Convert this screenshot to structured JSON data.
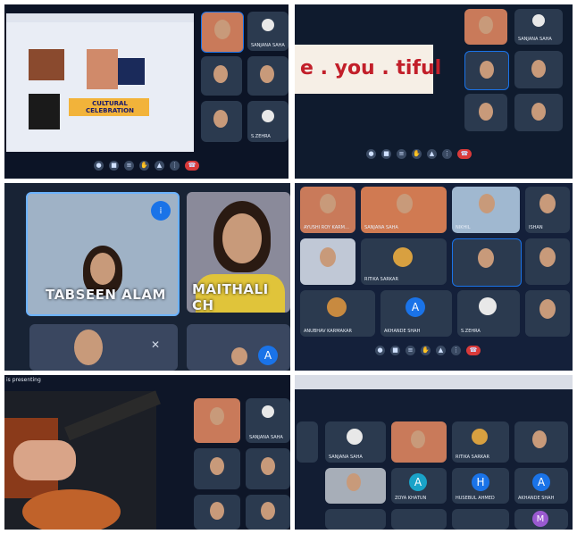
{
  "collage": {
    "p1": {
      "presentation_title": "CULTURAL CELEBRATION",
      "tiles": [
        "",
        "SANJANA SAHA",
        "",
        "",
        "",
        "S.ZEHRA"
      ]
    },
    "p2": {
      "banner_text": "e . you . tiful",
      "tiles": [
        "",
        "SANJANA SAHA",
        "",
        "",
        "",
        ""
      ]
    },
    "p3": {
      "tile_left_name": "TABSEEN ALAM",
      "tile_right_name": "MAITHALI CH",
      "avatar_letter": "A"
    },
    "p4": {
      "tiles": [
        "AYUSHI ROY KARMAKAR",
        "SANJANA SAHA",
        "NIKHIL",
        "ISHAN",
        "",
        "RITIKA SARKAR",
        "",
        "",
        "ANUBHAV KARMAKAR",
        "AKHANDE SHAH",
        "S.ZEHRA",
        ""
      ],
      "avatar_letter": "A"
    },
    "p5": {
      "presenting_label": "is presenting",
      "tiles": [
        "",
        "SANJANA SAHA",
        "",
        "",
        "",
        ""
      ]
    },
    "p6": {
      "tiles": [
        "",
        "SANJANA SAHA",
        "",
        "RITIKA SARKAR",
        "",
        "",
        "",
        "",
        "ZOYA KHATUN",
        "HUSEBUL AHMED",
        "AKHANDE SHAH",
        ""
      ],
      "avatar_letters": [
        "A",
        "H",
        "A",
        "M"
      ]
    }
  },
  "colors": {
    "accent_blue": "#1a73e8",
    "end_call_red": "#d93a3a",
    "tile_bg": "#2b3a4f"
  }
}
